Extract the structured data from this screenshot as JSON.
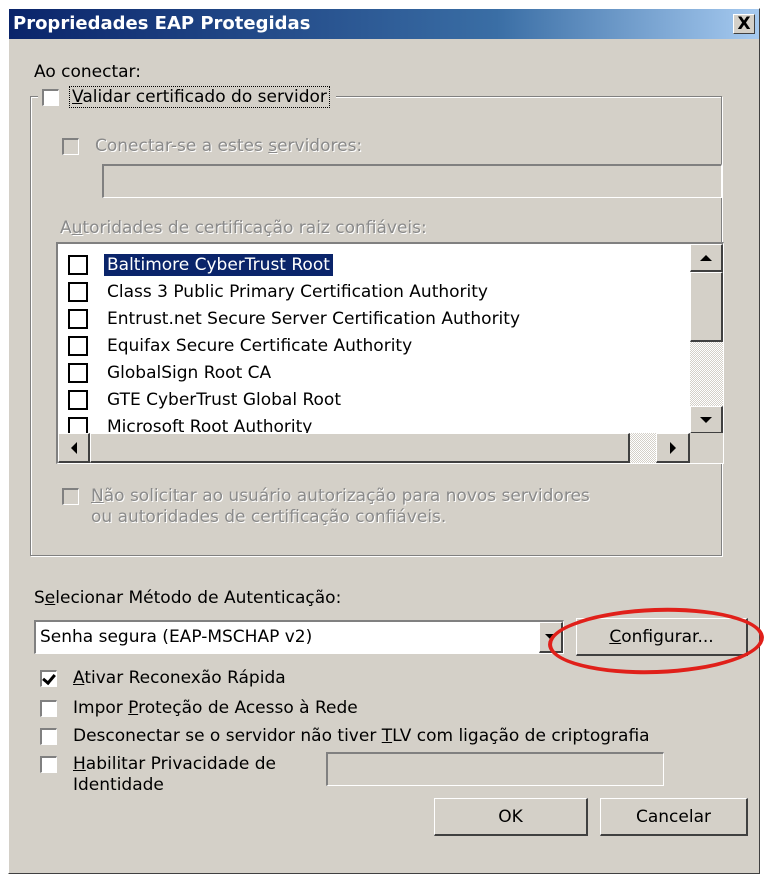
{
  "window": {
    "title": "Propriedades EAP Protegidas",
    "close_label": "X"
  },
  "on_connect": {
    "heading": "Ao conectar:",
    "validate_cert": {
      "label_mnemonic": "V",
      "label_rest": "alidar certificado do servidor",
      "checked": false
    },
    "connect_servers": {
      "label_pre": "Conectar-se a estes ",
      "label_mnemonic": "s",
      "label_rest": "ervidores:",
      "checked": false,
      "value": ""
    },
    "trusted_root_label_pre": "A",
    "trusted_root_label_mnemonic": "u",
    "trusted_root_label_rest": "toridades de certificação raiz confiáveis:",
    "authorities": [
      {
        "name": "Baltimore CyberTrust Root",
        "checked": false,
        "selected": true
      },
      {
        "name": "Class 3 Public Primary Certification Authority",
        "checked": false,
        "selected": false
      },
      {
        "name": "Entrust.net Secure Server Certification Authority",
        "checked": false,
        "selected": false
      },
      {
        "name": "Equifax Secure Certificate Authority",
        "checked": false,
        "selected": false
      },
      {
        "name": "GlobalSign Root CA",
        "checked": false,
        "selected": false
      },
      {
        "name": "GTE CyberTrust Global Root",
        "checked": false,
        "selected": false
      },
      {
        "name": "Microsoft Root Authority",
        "checked": false,
        "selected": false
      }
    ],
    "no_prompt": {
      "line1_mnemonic": "N",
      "line1_rest": "ão solicitar ao usuário autorização para novos servidores",
      "line2": "ou autoridades de certificação confiáveis.",
      "checked": false
    }
  },
  "auth": {
    "label_pre": "S",
    "label_mnemonic": "e",
    "label_rest": "lecionar Método de Autenticação:",
    "method": "Senha segura (EAP-MSCHAP v2)",
    "configure_mnemonic": "C",
    "configure_rest": "onfigurar..."
  },
  "options": {
    "fast_reconnect": {
      "mnemonic": "A",
      "rest": "tivar Reconexão Rápida",
      "checked": true
    },
    "nap": {
      "pre": "Impor ",
      "mnemonic": "P",
      "rest": "roteção de Acesso à Rede",
      "checked": false
    },
    "disconnect": {
      "pre": "Desconectar se o servidor não tiver ",
      "mnemonic": "T",
      "rest": "LV com ligação de criptografia",
      "checked": false
    },
    "identity_privacy": {
      "line1_mnemonic": "H",
      "line1_rest": "abilitar Privacidade de",
      "line2": "Identidade",
      "checked": false,
      "value": ""
    }
  },
  "buttons": {
    "ok": "OK",
    "cancel": "Cancelar"
  },
  "colors": {
    "face": "#d4d0c8",
    "title_start": "#0a246a",
    "title_end": "#a6caf0",
    "annotation": "#e0201a",
    "selection": "#0a246a"
  }
}
